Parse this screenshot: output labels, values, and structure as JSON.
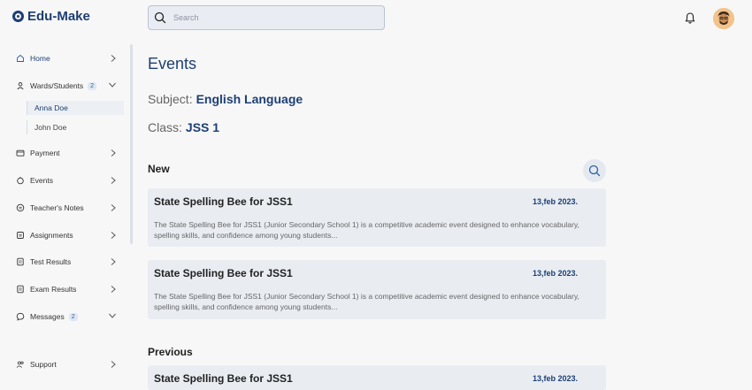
{
  "app": {
    "name": "Edu-Make"
  },
  "search": {
    "placeholder": "Search"
  },
  "sidebar": {
    "items": [
      {
        "label": "Home"
      },
      {
        "label": "Wards/Students",
        "badge": "2"
      },
      {
        "label": "Payment"
      },
      {
        "label": "Events"
      },
      {
        "label": "Teacher's Notes"
      },
      {
        "label": "Assignments"
      },
      {
        "label": "Test Results"
      },
      {
        "label": "Exam Results"
      },
      {
        "label": "Messages",
        "badge": "2"
      },
      {
        "label": "Support"
      }
    ],
    "students": [
      {
        "label": "Anna Doe"
      },
      {
        "label": "John Doe"
      }
    ]
  },
  "page": {
    "title": "Events",
    "subject_label": "Subject:",
    "subject_value": "English Language",
    "class_label": "Class:",
    "class_value": "JSS 1",
    "new_heading": "New",
    "previous_heading": "Previous"
  },
  "events": {
    "new": [
      {
        "title": "State Spelling Bee for JSS1",
        "date": "13,feb 2023.",
        "description": "The State Spelling Bee for JSS1 (Junior Secondary School 1) is a competitive academic event designed to enhance vocabulary, spelling skills, and confidence among young students..."
      },
      {
        "title": "State Spelling Bee for JSS1",
        "date": "13,feb 2023.",
        "description": "The State Spelling Bee for JSS1 (Junior Secondary School 1) is a competitive academic event designed to enhance vocabulary, spelling skills, and confidence among young students..."
      }
    ],
    "previous": [
      {
        "title": "State Spelling Bee for JSS1",
        "date": "13,feb 2023."
      }
    ]
  },
  "colors": {
    "brand": "#1d3f73",
    "card_bg": "#e9edf2",
    "badge_bg": "#dfe7f4"
  }
}
